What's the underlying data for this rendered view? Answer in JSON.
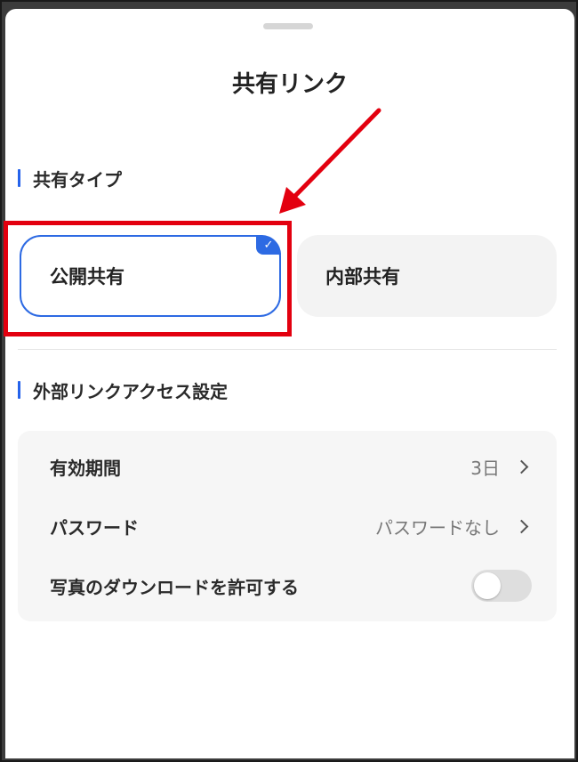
{
  "sheet": {
    "title": "共有リンク"
  },
  "share_type": {
    "header": "共有タイプ",
    "options": [
      {
        "label": "公開共有",
        "selected": true
      },
      {
        "label": "内部共有",
        "selected": false
      }
    ],
    "check_glyph": "✓"
  },
  "external_settings": {
    "header": "外部リンクアクセス設定",
    "rows": [
      {
        "label": "有効期間",
        "value": "3日"
      },
      {
        "label": "パスワード",
        "value": "パスワードなし"
      },
      {
        "label": "写真のダウンロードを許可する",
        "toggle_on": false
      }
    ]
  },
  "colors": {
    "accent": "#2d6ae3",
    "annotation": "#e3000f"
  }
}
